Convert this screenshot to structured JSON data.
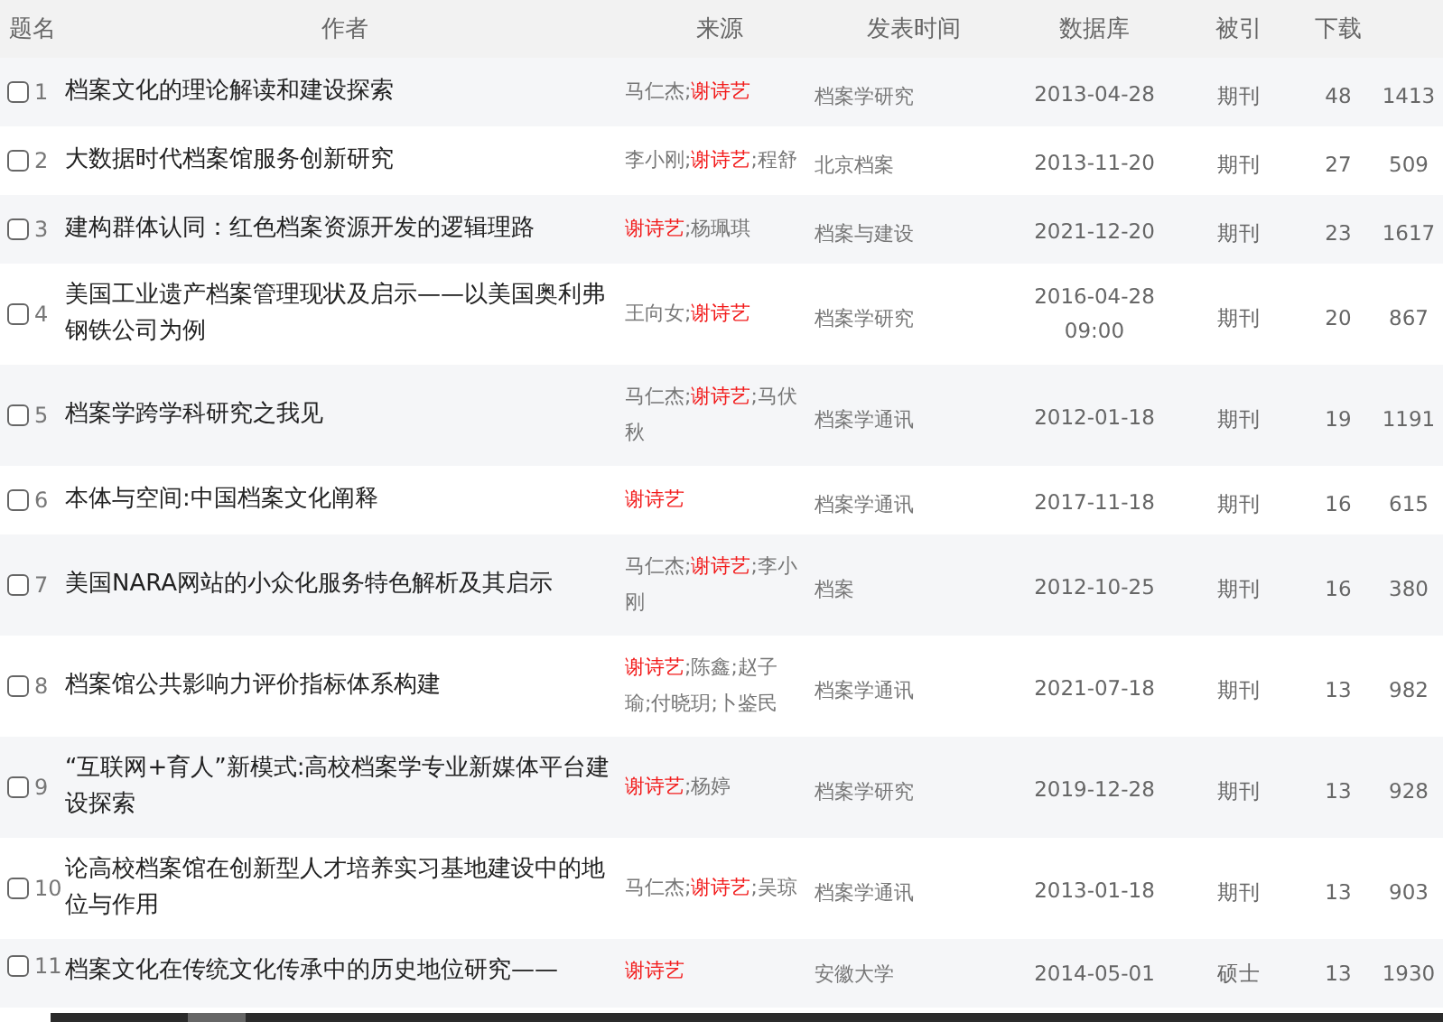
{
  "columns": [
    "题名",
    "作者",
    "来源",
    "发表时间",
    "数据库",
    "被引",
    "下载"
  ],
  "rows": [
    {
      "checked": false,
      "number": "1",
      "title": "档案文化的理论解读和建设探索",
      "authors": [
        {
          "text": "马仁杰;",
          "highlight": false
        },
        {
          "text": "谢诗艺",
          "highlight": true
        }
      ],
      "source": "档案学研究",
      "date": "2013-04-28",
      "database": "期刊",
      "citations": "48",
      "downloads": "1413"
    },
    {
      "checked": false,
      "number": "2",
      "title": "大数据时代档案馆服务创新研究",
      "authors": [
        {
          "text": "李小刚;",
          "highlight": false
        },
        {
          "text": "谢诗艺",
          "highlight": true
        },
        {
          "text": ";程舒",
          "highlight": false
        }
      ],
      "source": "北京档案",
      "date": "2013-11-20",
      "database": "期刊",
      "citations": "27",
      "downloads": "509"
    },
    {
      "checked": false,
      "number": "3",
      "title": "建构群体认同：红色档案资源开发的逻辑理路",
      "authors": [
        {
          "text": "谢诗艺",
          "highlight": true
        },
        {
          "text": ";杨珮琪",
          "highlight": false
        }
      ],
      "source": "档案与建设",
      "date": "2021-12-20",
      "database": "期刊",
      "citations": "23",
      "downloads": "1617"
    },
    {
      "checked": false,
      "number": "4",
      "title": "美国工业遗产档案管理现状及启示——以美国奥利弗钢铁公司为例",
      "authors": [
        {
          "text": "王向女;",
          "highlight": false
        },
        {
          "text": "谢诗艺",
          "highlight": true
        }
      ],
      "source": "档案学研究",
      "date": "2016-04-28 09:00",
      "database": "期刊",
      "citations": "20",
      "downloads": "867"
    },
    {
      "checked": false,
      "number": "5",
      "title": "档案学跨学科研究之我见",
      "authors": [
        {
          "text": "马仁杰;",
          "highlight": false
        },
        {
          "text": "谢诗艺",
          "highlight": true
        },
        {
          "text": ";马伏秋",
          "highlight": false
        }
      ],
      "source": "档案学通讯",
      "date": "2012-01-18",
      "database": "期刊",
      "citations": "19",
      "downloads": "1191"
    },
    {
      "checked": false,
      "number": "6",
      "title": "本体与空间:中国档案文化阐释",
      "authors": [
        {
          "text": "谢诗艺",
          "highlight": true
        }
      ],
      "source": "档案学通讯",
      "date": "2017-11-18",
      "database": "期刊",
      "citations": "16",
      "downloads": "615"
    },
    {
      "checked": false,
      "number": "7",
      "title": "美国NARA网站的小众化服务特色解析及其启示",
      "authors": [
        {
          "text": "马仁杰;",
          "highlight": false
        },
        {
          "text": "谢诗艺",
          "highlight": true
        },
        {
          "text": ";李小刚",
          "highlight": false
        }
      ],
      "source": "档案",
      "date": "2012-10-25",
      "database": "期刊",
      "citations": "16",
      "downloads": "380"
    },
    {
      "checked": false,
      "number": "8",
      "title": "档案馆公共影响力评价指标体系构建",
      "authors": [
        {
          "text": "谢诗艺",
          "highlight": true
        },
        {
          "text": ";陈鑫;赵子瑜;付晓玥;卜鉴民",
          "highlight": false
        }
      ],
      "source": "档案学通讯",
      "date": "2021-07-18",
      "database": "期刊",
      "citations": "13",
      "downloads": "982"
    },
    {
      "checked": false,
      "number": "9",
      "title": "“互联网+育人”新模式:高校档案学专业新媒体平台建设探索",
      "authors": [
        {
          "text": "谢诗艺",
          "highlight": true
        },
        {
          "text": ";杨婷",
          "highlight": false
        }
      ],
      "source": "档案学研究",
      "date": "2019-12-28",
      "database": "期刊",
      "citations": "13",
      "downloads": "928"
    },
    {
      "checked": false,
      "number": "10",
      "title": "论高校档案馆在创新型人才培养实习基地建设中的地位与作用",
      "authors": [
        {
          "text": "马仁杰;",
          "highlight": false
        },
        {
          "text": "谢诗艺",
          "highlight": true
        },
        {
          "text": ";吴琼",
          "highlight": false
        }
      ],
      "source": "档案学通讯",
      "date": "2013-01-18",
      "database": "期刊",
      "citations": "13",
      "downloads": "903"
    },
    {
      "checked": false,
      "number": "11",
      "title": "档案文化在传统文化传承中的历史地位研究——",
      "authors": [
        {
          "text": "谢诗艺",
          "highlight": true
        }
      ],
      "source": "安徽大学",
      "date": "2014-05-01",
      "database": "硕士",
      "citations": "13",
      "downloads": "1930"
    }
  ]
}
